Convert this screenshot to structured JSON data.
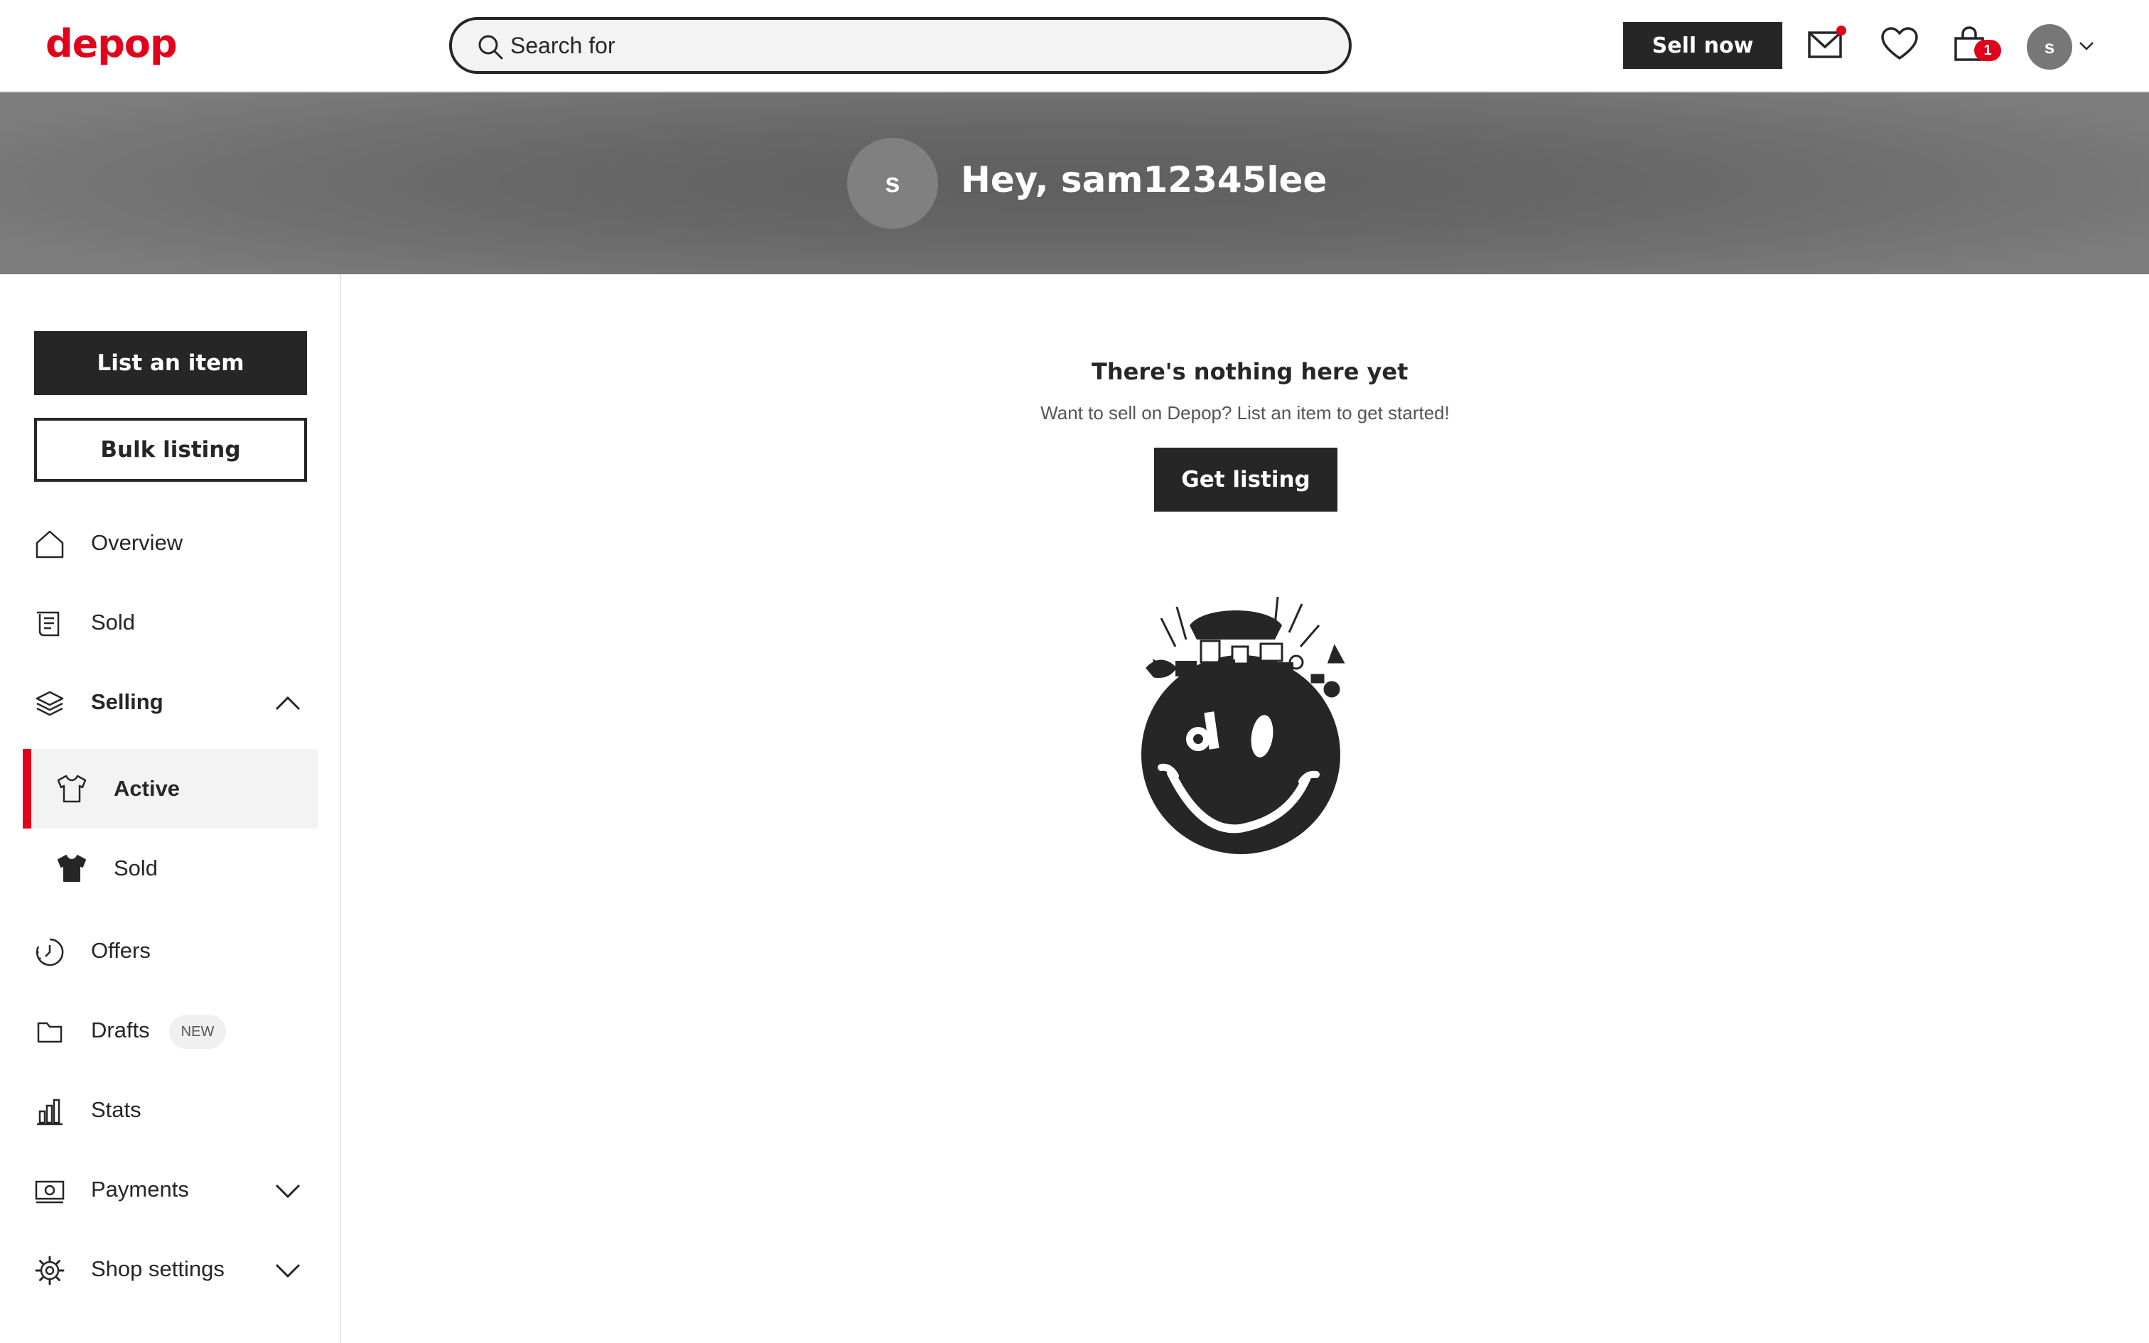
{
  "header": {
    "logo": "depop",
    "search_placeholder": "Search for",
    "sell_now": "Sell now",
    "bag_count": "1",
    "avatar_initial": "s",
    "icons": [
      "search-icon",
      "mail-icon",
      "heart-icon",
      "bag-icon",
      "chevron-down-icon"
    ],
    "accent_color": "#e3001b"
  },
  "banner": {
    "avatar_initial": "s",
    "greeting": "Hey, sam12345lee"
  },
  "sidebar": {
    "list_item": "List an item",
    "bulk_listing": "Bulk listing",
    "nav": {
      "overview": "Overview",
      "sold": "Sold",
      "selling": "Selling",
      "active": "Active",
      "selling_sold": "Sold",
      "offers": "Offers",
      "drafts": "Drafts",
      "drafts_badge": "NEW",
      "stats": "Stats",
      "payments": "Payments",
      "shop_settings": "Shop settings"
    }
  },
  "main": {
    "empty_title": "There's nothing here yet",
    "empty_subtitle": "Want to sell on Depop? List an item to get started!",
    "cta": "Get listing"
  }
}
